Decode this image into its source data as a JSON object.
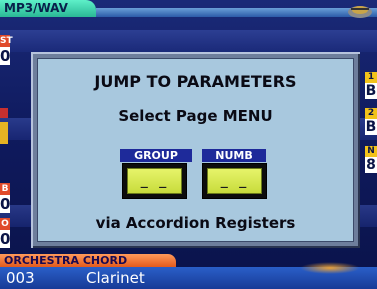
{
  "app": {
    "title": "MP3/WAV"
  },
  "left_panel": {
    "top_label": "ST",
    "top_value": "0",
    "mid_label_1": "B",
    "mid_value_1": "0",
    "mid_label_2": "O",
    "mid_value_2": "0"
  },
  "right_panel": {
    "items": [
      {
        "label": "1",
        "value": "B"
      },
      {
        "label": "2",
        "value": "B"
      },
      {
        "label": "N",
        "value": "8"
      }
    ]
  },
  "dialog": {
    "title": "JUMP TO PARAMETERS",
    "subtitle": "Select Page MENU",
    "group_label": "GROUP",
    "group_value": "_ _",
    "numb_label": "NUMB",
    "numb_value": "_ _",
    "footer": "via Accordion Registers"
  },
  "bottom": {
    "section": "ORCHESTRA CHORD",
    "number": "003",
    "name": "Clarinet"
  },
  "colors": {
    "app_tab": "#2ab895",
    "dialog_bg": "#a8c8de",
    "field_fill": "#d4e64e",
    "field_label": "#1e2a9a",
    "bottom_tab": "#e35a1c"
  }
}
